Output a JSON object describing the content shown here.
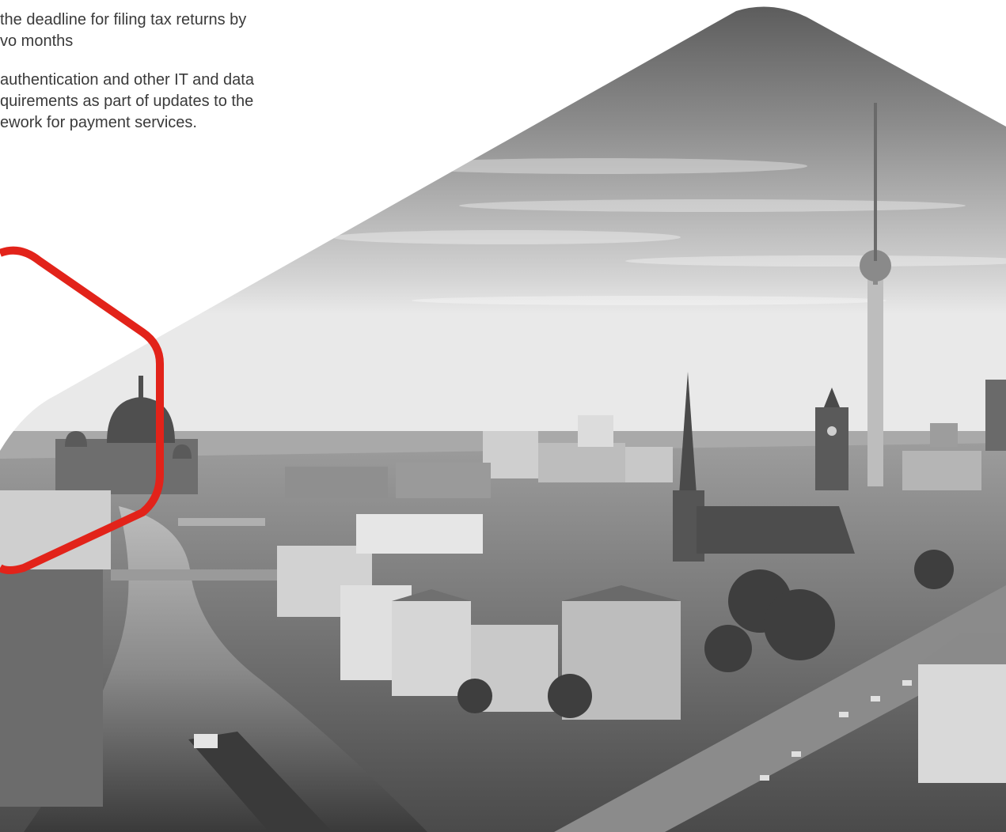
{
  "body_text": {
    "paragraph_1": [
      "the deadline for filing tax returns by",
      "vo months"
    ],
    "paragraph_2": [
      " authentication and other IT and data",
      "quirements as part of updates to the",
      "ework for payment services."
    ]
  },
  "photo": {
    "subject": "Aerial black-and-white view of Berlin city with TV tower, cathedral dome and river Spree"
  },
  "colors": {
    "accent_outline": "#e2231a",
    "text": "#3a3a3a"
  }
}
